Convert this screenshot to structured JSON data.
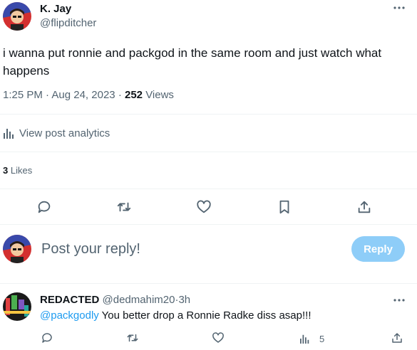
{
  "post": {
    "author_name": "K. Jay",
    "author_handle": "@flipditcher",
    "text": "i wanna put ronnie and packgod in the same room and just watch what happens",
    "time": "1:25 PM",
    "separator": "·",
    "date": "Aug 24, 2023",
    "views_count": "252",
    "views_label": "Views",
    "analytics_label": "View post analytics",
    "likes_count": "3",
    "likes_label": "Likes",
    "more_icon": "more-horizontal-icon"
  },
  "actions": [
    {
      "icon": "reply-icon"
    },
    {
      "icon": "retweet-icon"
    },
    {
      "icon": "heart-icon"
    },
    {
      "icon": "bookmark-icon"
    },
    {
      "icon": "share-icon"
    }
  ],
  "composer": {
    "placeholder": "Post your reply!",
    "button_label": "Reply",
    "button_color": "#8ecdf8"
  },
  "reply": {
    "author_name": "REDACTED",
    "author_handle": "@dedmahim20",
    "separator": "·",
    "time": "3h",
    "mention": "@packgodly",
    "text": " You better drop a Ronnie Radke diss asap!!!",
    "views_count": "5",
    "mention_color": "#1d9bf0"
  },
  "colors": {
    "text": "#0f1419",
    "muted": "#536471",
    "divider": "#eff3f4",
    "accent": "#1d9bf0"
  }
}
